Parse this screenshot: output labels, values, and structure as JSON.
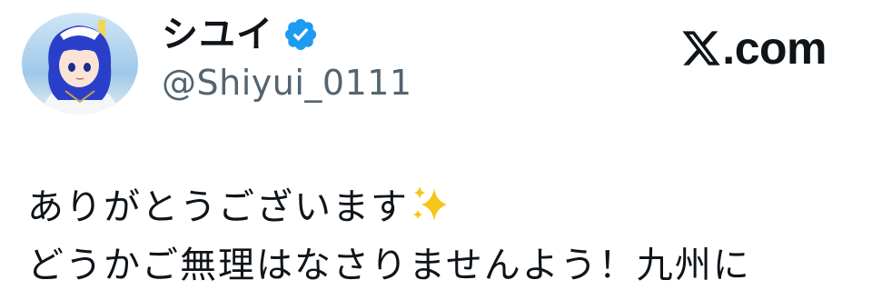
{
  "author": {
    "display_name": "シユイ",
    "handle": "@Shiyui_0111",
    "avatar_icon": "anime-character-avatar",
    "verified_icon": "verified-badge-icon"
  },
  "brand": {
    "logo_icon": "x-logo-icon",
    "suffix": ".com"
  },
  "tweet": {
    "lines": [
      "ありがとうございます",
      "どうかご無理はなさりませんよう！九州に"
    ],
    "emoji_icon": "sparkles-icon"
  },
  "colors": {
    "verified": "#1d9bf0",
    "secondary_text": "#536471",
    "sparkle": "#f5c518"
  }
}
